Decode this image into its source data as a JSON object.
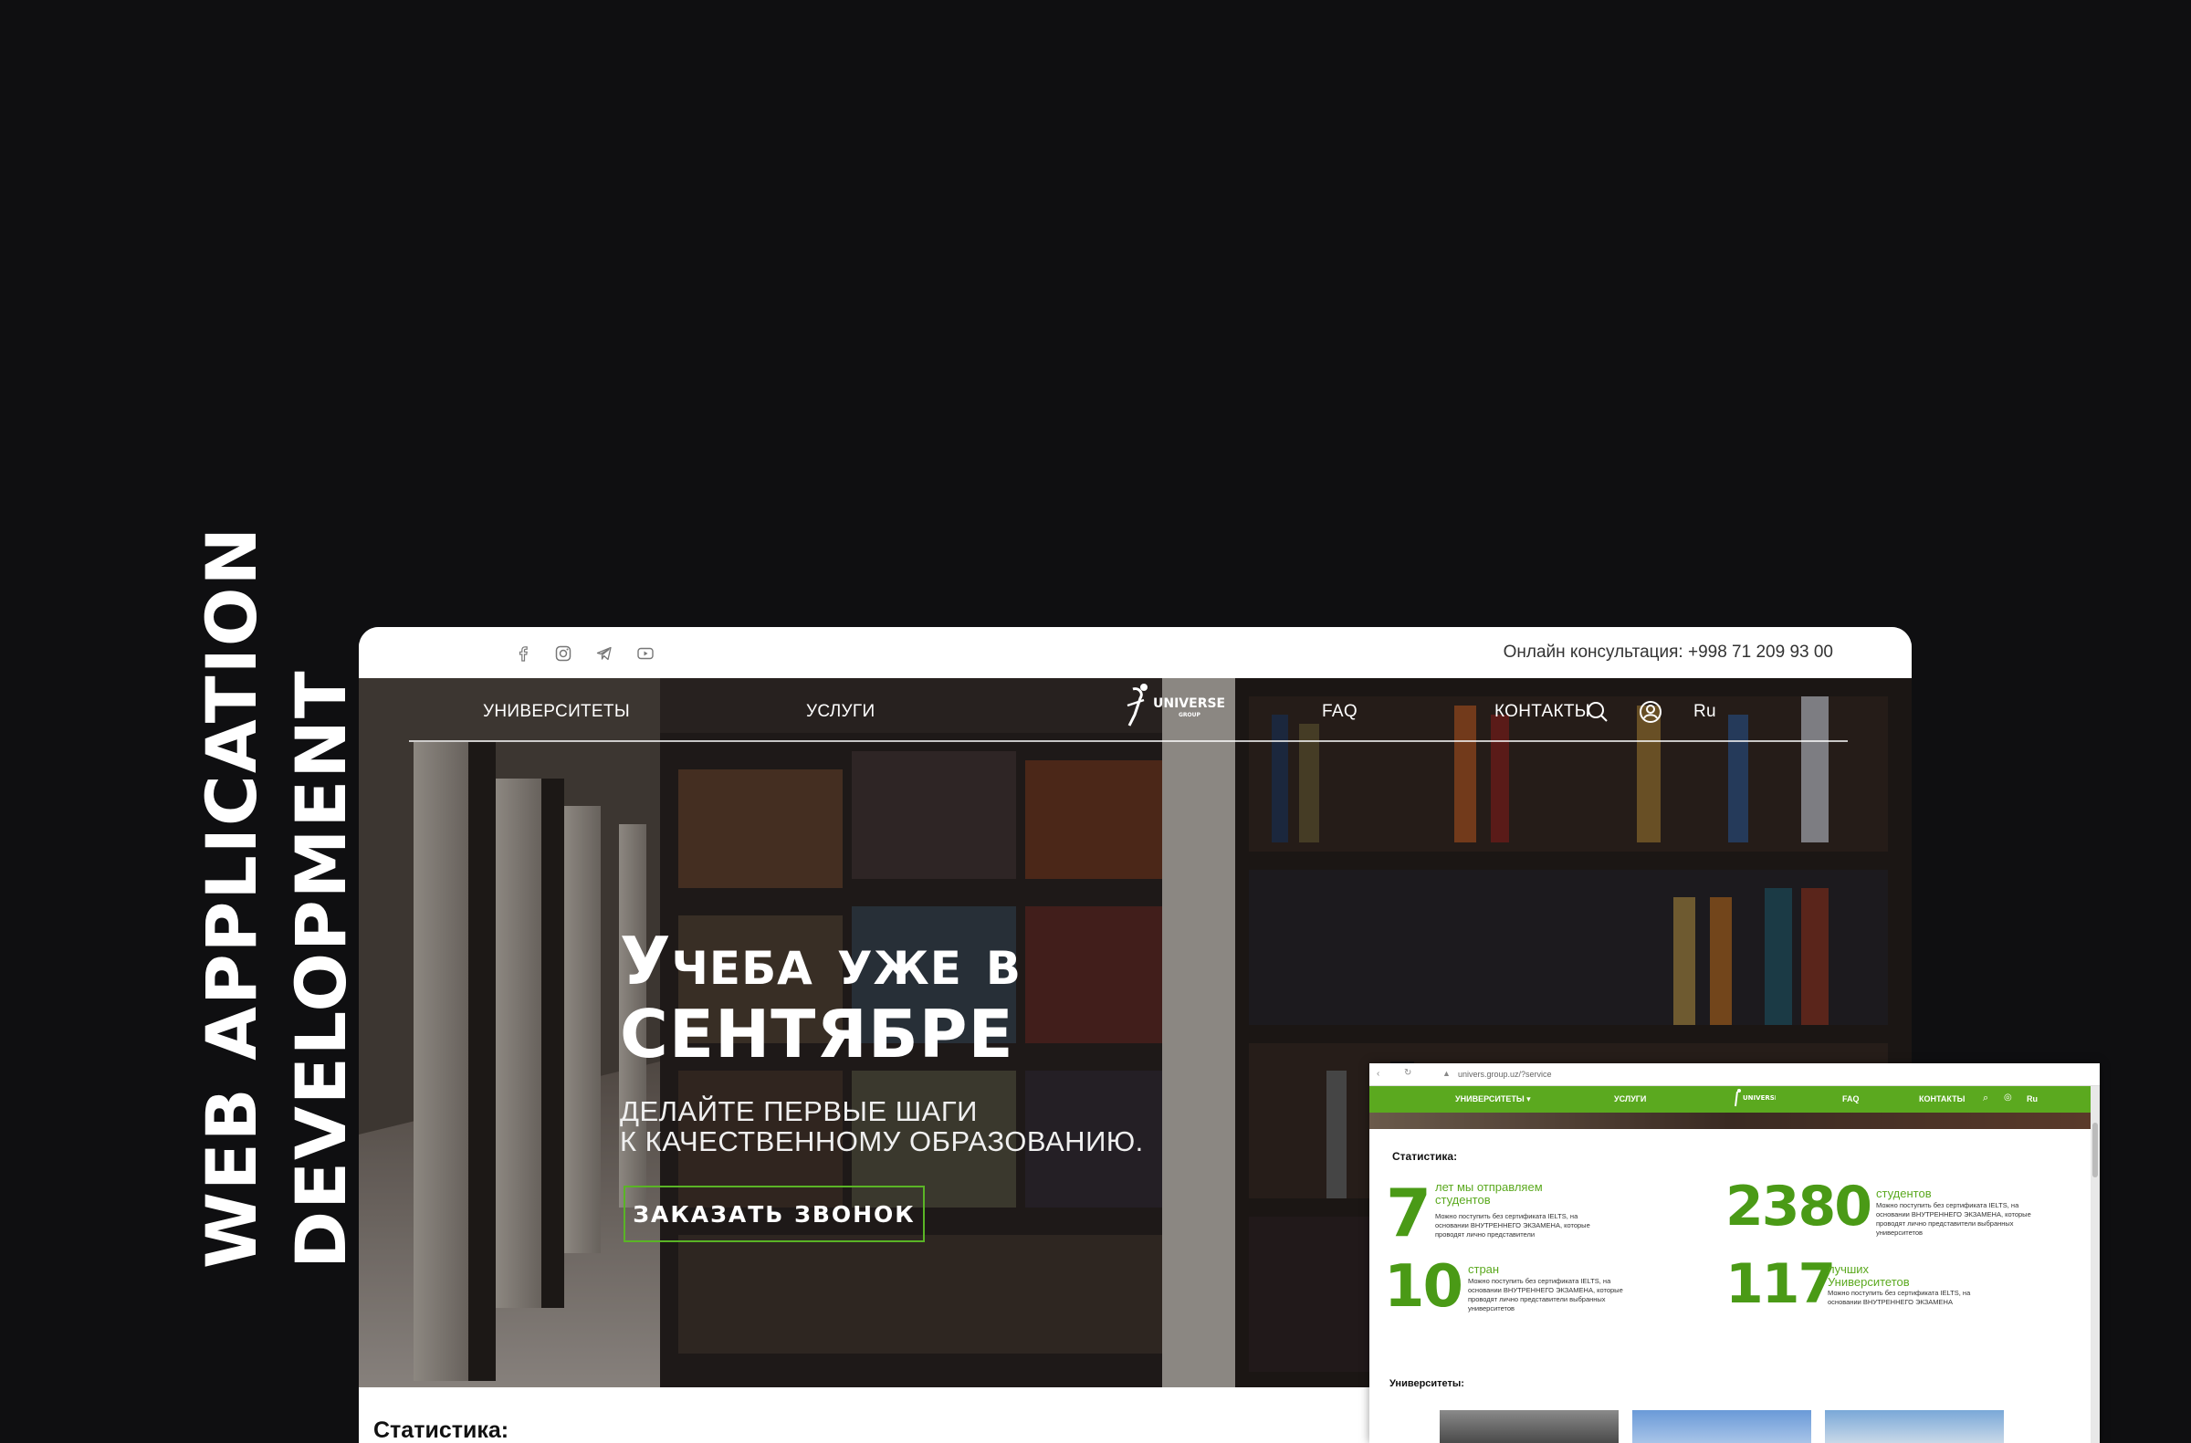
{
  "side_title": {
    "line1": "WEB APPLICATION",
    "line2": "DEVELOPMENT"
  },
  "topbar": {
    "social_icons": [
      "facebook-icon",
      "instagram-icon",
      "telegram-icon",
      "youtube-icon"
    ],
    "consultation": "Онлайн консультация: +998 71 209 93 00"
  },
  "nav": {
    "universities": "УНИВЕРСИТЕТЫ",
    "services": "УСЛУГИ",
    "logo_text": "UNIVERSE",
    "logo_sub": "GROUP",
    "faq": "FAQ",
    "contacts": "КОНТАКТЫ",
    "lang": "Ru"
  },
  "hero": {
    "headline_line1": "Учеба уже в",
    "headline_line2": "сентябре",
    "sub_line1": "ДЕЛАЙТЕ ПЕРВЫЕ ШАГИ",
    "sub_line2": "К КАЧЕСТВЕННОМУ ОБРАЗОВАНИЮ.",
    "cta": "ЗАКАЗАТЬ ЗВОНОК"
  },
  "stats_heading": "Статистика:",
  "mini": {
    "url": "univers.group.uz/?service",
    "nav": [
      "УНИВЕРСИТЕТЫ ▾",
      "УСЛУГИ",
      "FAQ",
      "КОНТАКТЫ",
      "Ru"
    ],
    "stats_heading": "Статистика:",
    "stats": [
      {
        "number": "7",
        "caption": "лет мы отправляем студентов",
        "desc": "Можно поступить без сертификата IELTS, на основании ВНУТРЕННЕГО ЭКЗАМЕНА, которые проводят лично представители"
      },
      {
        "number": "2380",
        "caption": "студентов",
        "desc": "Можно поступить без сертификата IELTS, на основании ВНУТРЕННЕГО ЭКЗАМЕНА, которые проводят лично представители выбранных университетов"
      },
      {
        "number": "10",
        "caption": "стран",
        "desc": "Можно поступить без сертификата IELTS, на основании ВНУТРЕННЕГО ЭКЗАМЕНА, которые проводят лично представители выбранных университетов"
      },
      {
        "number": "117",
        "caption": "лучших Университетов",
        "desc": "Можно поступить без сертификата IELTS, на основании ВНУТРЕННЕГО ЭКЗАМЕНА"
      }
    ],
    "universities_heading": "Университеты:"
  },
  "colors": {
    "accent": "#5ab426",
    "bg": "#0f0f11"
  }
}
